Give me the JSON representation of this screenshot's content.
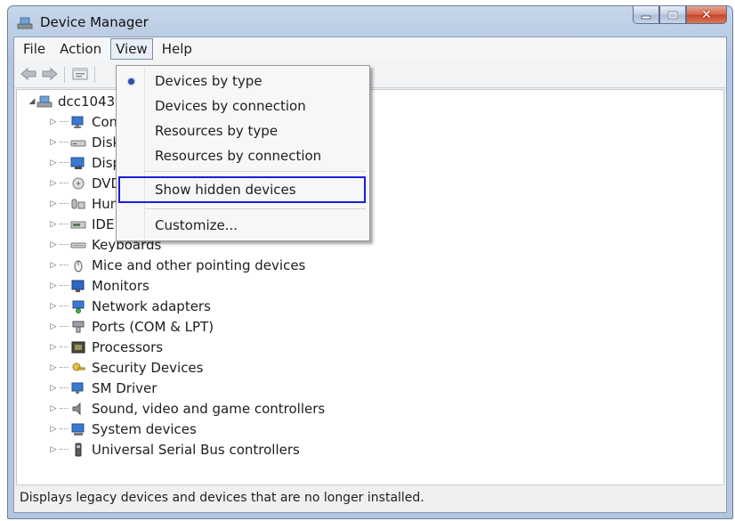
{
  "window": {
    "title": "Device Manager"
  },
  "menubar": {
    "items": [
      "File",
      "Action",
      "View",
      "Help"
    ],
    "open_menu": "View"
  },
  "toolbar": {
    "buttons": [
      "back-icon",
      "forward-icon",
      "properties-icon"
    ]
  },
  "view_menu": {
    "items": [
      {
        "label": "Devices by type",
        "selected": true
      },
      {
        "label": "Devices by connection",
        "selected": false
      },
      {
        "label": "Resources by type",
        "selected": false
      },
      {
        "label": "Resources by connection",
        "selected": false
      },
      {
        "label": "Show hidden devices",
        "highlighted": true
      },
      {
        "label": "Customize..."
      }
    ]
  },
  "tree": {
    "root": "dcc1043",
    "items": [
      {
        "label": "Com",
        "icon": "computer-icon"
      },
      {
        "label": "Disk",
        "icon": "disk-drive-icon"
      },
      {
        "label": "Disp",
        "icon": "display-adapter-icon"
      },
      {
        "label": "DVD",
        "icon": "dvd-drive-icon"
      },
      {
        "label": "Hum",
        "icon": "hid-icon"
      },
      {
        "label": "IDE A",
        "icon": "ide-controller-icon"
      },
      {
        "label": "Keyboards",
        "icon": "keyboard-icon"
      },
      {
        "label": "Mice and other pointing devices",
        "icon": "mouse-icon"
      },
      {
        "label": "Monitors",
        "icon": "monitor-icon"
      },
      {
        "label": "Network adapters",
        "icon": "network-adapter-icon"
      },
      {
        "label": "Ports (COM & LPT)",
        "icon": "port-icon"
      },
      {
        "label": "Processors",
        "icon": "processor-icon"
      },
      {
        "label": "Security Devices",
        "icon": "security-device-icon"
      },
      {
        "label": "SM Driver",
        "icon": "sm-driver-icon"
      },
      {
        "label": "Sound, video and game controllers",
        "icon": "sound-icon"
      },
      {
        "label": "System devices",
        "icon": "system-devices-icon"
      },
      {
        "label": "Universal Serial Bus controllers",
        "icon": "usb-icon"
      }
    ]
  },
  "statusbar": {
    "text": "Displays legacy devices and devices that are no longer installed."
  }
}
